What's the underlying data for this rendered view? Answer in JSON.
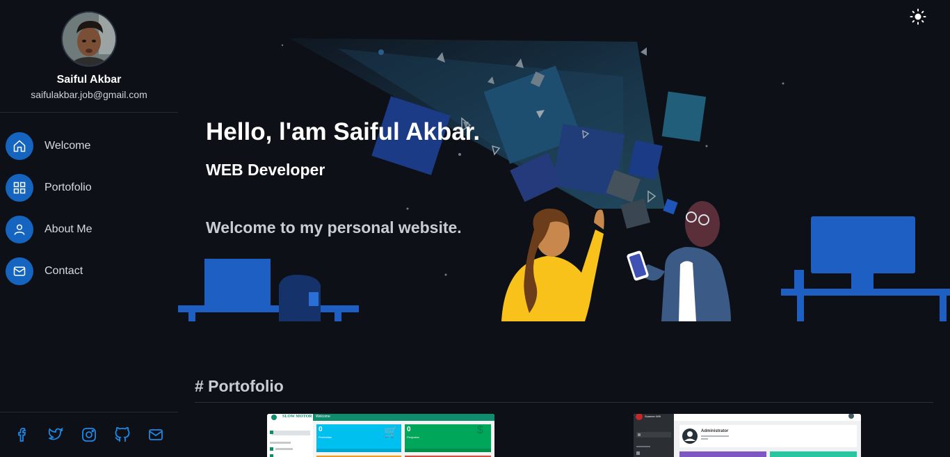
{
  "profile": {
    "name": "Saiful Akbar",
    "email": "saifulakbar.job@gmail.com"
  },
  "nav": {
    "items": [
      {
        "label": "Welcome",
        "icon": "home-icon"
      },
      {
        "label": "Portofolio",
        "icon": "grid-icon"
      },
      {
        "label": "About Me",
        "icon": "user-icon"
      },
      {
        "label": "Contact",
        "icon": "mail-icon"
      }
    ]
  },
  "social": [
    "facebook-icon",
    "twitter-icon",
    "instagram-icon",
    "github-icon",
    "mail-icon"
  ],
  "hero": {
    "title": "Hello, l'am Saiful Akbar.",
    "subtitle": "WEB Developer",
    "welcome": "Welcome to my personal website."
  },
  "portfolio": {
    "title": "# Portofolio",
    "card1": {
      "brand": "SLOW MOTOR",
      "header": "Welcome",
      "tile1_value": "0",
      "tile1_label": "Pembelian",
      "tile2_value": "0",
      "tile2_label": "Penjualan"
    },
    "card2": {
      "brand": "Scanner Wifi",
      "user": "Administrator"
    }
  },
  "colors": {
    "accent": "#1565c0",
    "background": "#0d1117",
    "sun": "#ffffff"
  }
}
